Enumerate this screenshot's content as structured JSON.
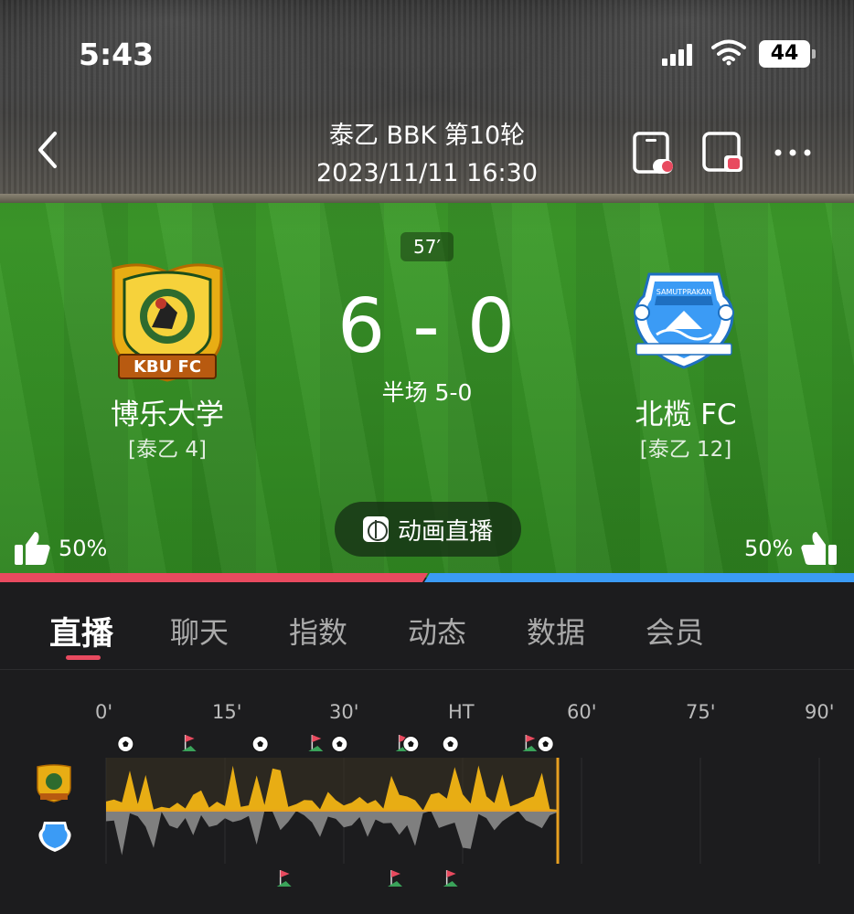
{
  "status": {
    "time": "5:43",
    "battery": "44"
  },
  "header": {
    "league": "泰乙 BBK 第10轮",
    "datetime": "2023/11/11 16:30"
  },
  "match": {
    "minute": "57′",
    "score": "6 - 0",
    "halftime": "半场 5-0",
    "home": {
      "name": "博乐大学",
      "rank": "[泰乙 4]",
      "logo_text": "KBU FC",
      "like_pct": "50%"
    },
    "away": {
      "name": "北榄 FC",
      "rank": "[泰乙 12]",
      "logo_text": "SAMUTPRAKAN",
      "like_pct": "50%"
    }
  },
  "anim_button": {
    "label": "动画直播",
    "icon": "animation-icon"
  },
  "tabs": [
    {
      "label": "直播",
      "active": true
    },
    {
      "label": "聊天"
    },
    {
      "label": "指数"
    },
    {
      "label": "动态"
    },
    {
      "label": "数据"
    },
    {
      "label": "会员"
    }
  ],
  "timeline": {
    "ticks": [
      "0'",
      "15'",
      "30'",
      "HT",
      "60'",
      "75'",
      "90'"
    ],
    "current_minute": 57,
    "home_events": [
      {
        "type": "goal",
        "minute": 2
      },
      {
        "type": "corner",
        "minute": 10
      },
      {
        "type": "goal",
        "minute": 19
      },
      {
        "type": "corner",
        "minute": 26
      },
      {
        "type": "goal",
        "minute": 29
      },
      {
        "type": "corner",
        "minute": 37
      },
      {
        "type": "goal",
        "minute": 38
      },
      {
        "type": "goal",
        "minute": 43
      },
      {
        "type": "corner",
        "minute": 53
      },
      {
        "type": "goal",
        "minute": 55
      }
    ],
    "away_events": [
      {
        "type": "corner",
        "minute": 22
      },
      {
        "type": "corner",
        "minute": 36
      },
      {
        "type": "corner",
        "minute": 43
      }
    ],
    "colors": {
      "home": "#e8ad14",
      "away": "#7f7f7f",
      "line": "#e8a020"
    }
  },
  "colors": {
    "home_bar": "#e84a5f",
    "away_bar": "#3b9bf5",
    "accent": "#e84a5f"
  }
}
